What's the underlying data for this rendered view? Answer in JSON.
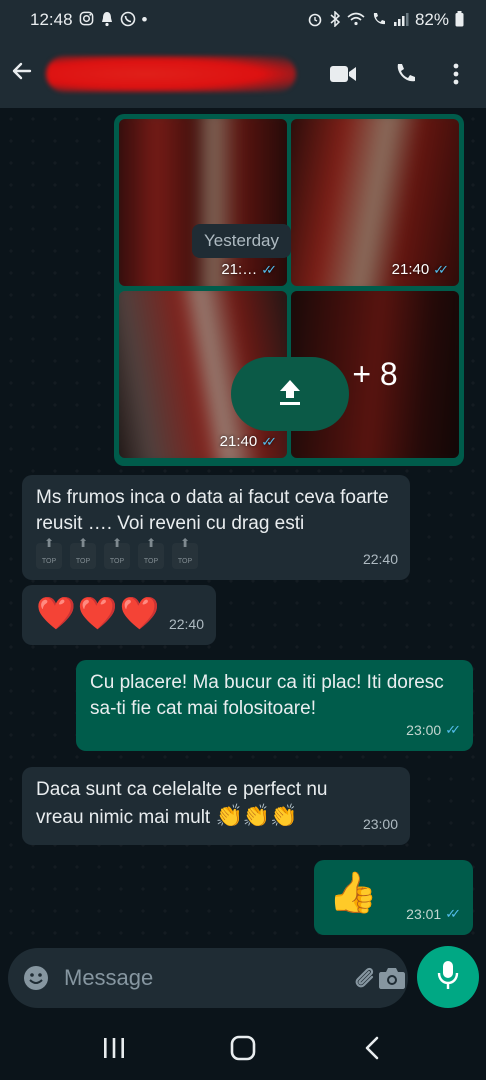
{
  "status_bar": {
    "time": "12:48",
    "left_icons": [
      "instagram-icon",
      "notification-icon",
      "whatsapp-icon"
    ],
    "dot": "•",
    "right_icons": [
      "alarm-icon",
      "bluetooth-icon",
      "wifi-icon",
      "call-icon",
      "signal-icon"
    ],
    "battery": "82%"
  },
  "app_bar": {
    "contact_name": "",
    "actions": [
      "video-call-icon",
      "voice-call-icon",
      "more-options-icon"
    ]
  },
  "chat": {
    "date_chip": "Yesterday",
    "media_group": {
      "tiles": [
        {
          "time": "21:…",
          "ticks": "✓✓"
        },
        {
          "time": "21:40",
          "ticks": "✓✓"
        },
        {
          "time": "21:40",
          "ticks": "✓✓"
        },
        {
          "more": "+ 8"
        }
      ],
      "upload_icon": "upload-icon"
    },
    "messages": [
      {
        "direction": "in",
        "text": "Ms frumos inca o data ai facut ceva foarte reusit …. Voi reveni cu drag esti",
        "emoji_badges": [
          "TOP",
          "TOP",
          "TOP",
          "TOP",
          "TOP"
        ],
        "time": "22:40"
      },
      {
        "direction": "in",
        "text": "❤️❤️❤️",
        "time": "22:40"
      },
      {
        "direction": "out",
        "text": "Cu placere! Ma bucur ca iti plac! Iti doresc sa-ti fie cat mai folositoare!",
        "time": "23:00",
        "ticks": "✓✓"
      },
      {
        "direction": "in",
        "text": "Daca sunt ca celelalte e perfect nu vreau nimic mai mult",
        "emoji": "👏👏👏",
        "time": "23:00"
      },
      {
        "direction": "out",
        "text": "👍",
        "time": "23:01",
        "ticks": "✓✓"
      }
    ]
  },
  "composer": {
    "placeholder": "Message",
    "value": "",
    "icons": [
      "emoji-icon",
      "attach-icon",
      "camera-icon",
      "mic-icon"
    ]
  },
  "colors": {
    "background": "#0b141a",
    "incoming_bubble": "#1f2c34",
    "outgoing_bubble": "#005c4b",
    "accent": "#00a884",
    "read_ticks": "#53bdeb"
  }
}
